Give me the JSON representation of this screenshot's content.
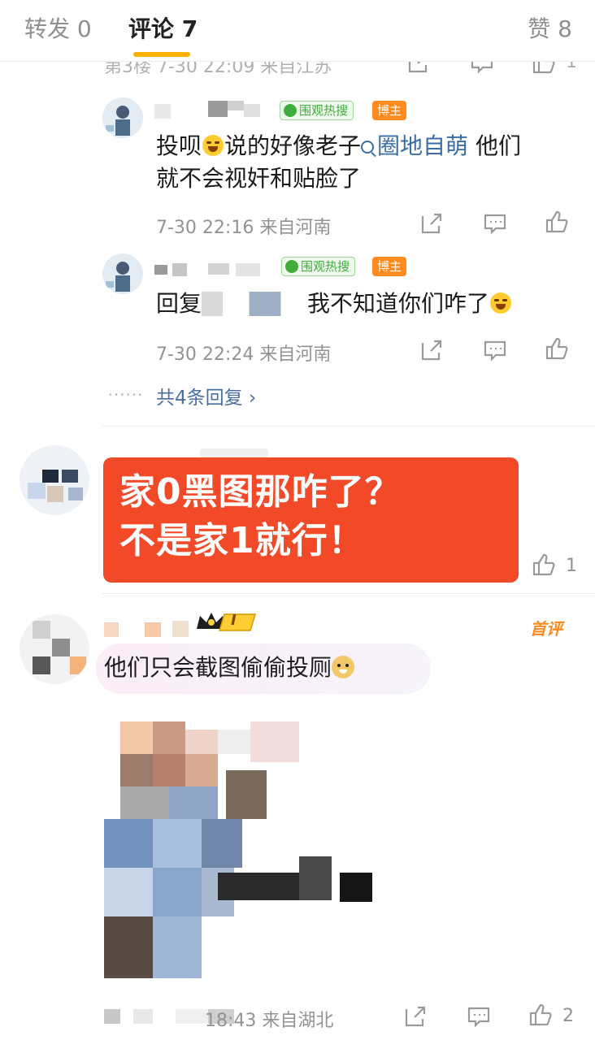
{
  "tabs": {
    "repost": "转发 0",
    "comment": "评论 7",
    "like": "赞 8"
  },
  "comment_top_cut": {
    "meta": "第3楼 7-30 22:09 来自江苏",
    "like_count": "1"
  },
  "reply1": {
    "badge_weiguan": "围观热搜",
    "badge_bozhu": "博主",
    "text_before": "投呗",
    "text_mid": "说的好像老子",
    "link": "圈地自萌",
    "text_after": " 他们",
    "text_line2": "就不会视奸和贴脸了",
    "meta": "7-30 22:16  来自河南"
  },
  "reply2": {
    "badge_weiguan": "围观热搜",
    "badge_bozhu": "博主",
    "text_prefix": "回复",
    "text_suffix": "我不知道你们咋了",
    "meta": "7-30 22:24  来自河南"
  },
  "more_replies": {
    "dots": "……",
    "label": "共4条回复 ›"
  },
  "comment2": {
    "like_count": "1",
    "overlay_line1": "家0黑图那咋了？",
    "overlay_line2": "不是家1就行！"
  },
  "comment3": {
    "level_badge": "I",
    "first_comment_tag": "首评",
    "text": "他们只会截图偷偷投厕",
    "meta": "18:43  来自湖北",
    "like_count": "2"
  },
  "icons": {
    "share": "share-icon",
    "comment": "comment-icon",
    "like": "thumb-up-icon",
    "emoji_laugh": "laugh-cry-emoji",
    "emoji_doge": "doge-emoji"
  },
  "colors": {
    "accent": "#ffb300",
    "banner_red": "#f24a28",
    "link_blue": "#3a6ea5",
    "bozhu_orange": "#ff8a1f",
    "weiguan_green": "#3fae3a"
  }
}
